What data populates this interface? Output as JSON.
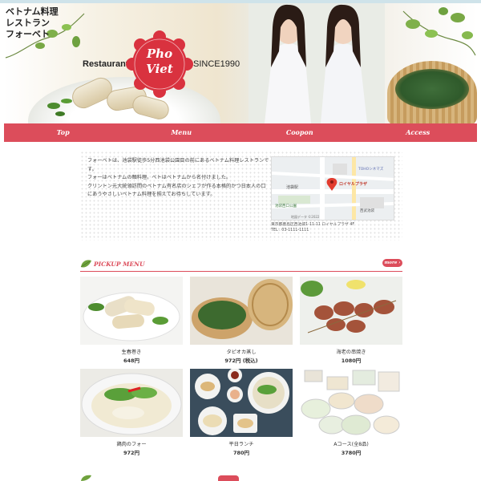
{
  "header": {
    "logo_lines": [
      "ベトナム料理",
      "レストラン",
      "フォーベト"
    ],
    "restaurant_label": "Restaurant",
    "badge_line1": "Pho",
    "badge_line2": "Viet",
    "since_label": "SINCE1990"
  },
  "nav": {
    "items": [
      {
        "label": "Top"
      },
      {
        "label": "Menu"
      },
      {
        "label": "Coopon"
      },
      {
        "label": "Access"
      }
    ]
  },
  "info": {
    "paragraphs": [
      "フォーベトは、池袋駅徒歩5分西池袋公園目の前にあるベトナム料理レストランです。",
      "フォーはベトナムの麺料理。ベトはベトナムから名付けました。",
      "クリントン元大統領訪問のベトナム有名店のシェフが作る本格的かつ日本人の口にあうやさしいベトナム料理を揃えてお待ちしています。"
    ],
    "address": "東京都豊島区西池袋1-11-11 ロイヤルプラザ 4F",
    "tel": "TEL : 03-1111-1111",
    "map_labels": {
      "station": "池袋駅",
      "building": "ロイヤルプラザ",
      "toho": "TOHOシネマズ",
      "park": "池袋西口公園",
      "seibu": "西武池袋",
      "map_data": "地図データ ©2022"
    }
  },
  "pickup": {
    "title": "PICKUP MENU",
    "more_label": "more",
    "items": [
      {
        "name": "生春巻き",
        "price": "648円"
      },
      {
        "name": "タピオカ蒸し",
        "price": "972円 (税込)"
      },
      {
        "name": "海老の串焼き",
        "price": "1080円"
      },
      {
        "name": "鶏肉のフォー",
        "price": "972円"
      },
      {
        "name": "平日ランチ",
        "price": "780円"
      },
      {
        "name": "Aコース(全8品)",
        "price": "3780円"
      }
    ]
  },
  "colors": {
    "accent": "#dc4d5b",
    "text": "#333333"
  }
}
